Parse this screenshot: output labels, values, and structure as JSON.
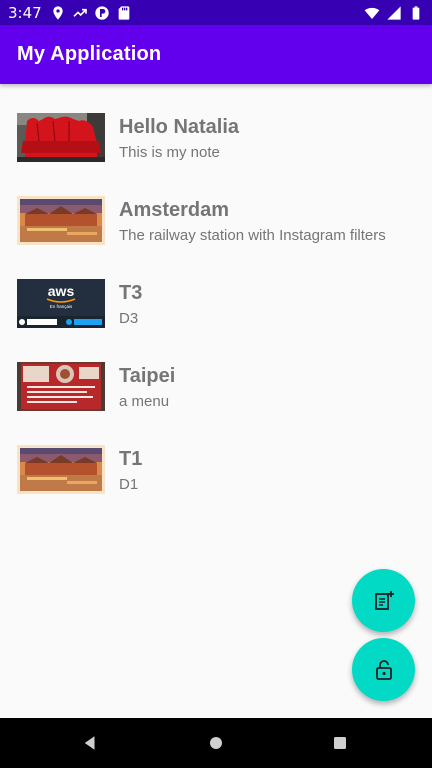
{
  "status_bar": {
    "time": "3:47",
    "icons": [
      "location-icon",
      "trending-icon",
      "p-badge-icon",
      "sd-card-icon",
      "wifi-icon",
      "signal-icon",
      "battery-icon"
    ]
  },
  "app_bar": {
    "title": "My Application"
  },
  "notes": [
    {
      "title": "Hello Natalia",
      "description": "This is my note",
      "image": "red-couch"
    },
    {
      "title": "Amsterdam",
      "description": "The railway station with Instagram filters",
      "image": "amsterdam-station"
    },
    {
      "title": "T3",
      "description": "D3",
      "image": "aws-card"
    },
    {
      "title": "Taipei",
      "description": "a menu",
      "image": "menu-photo"
    },
    {
      "title": "T1",
      "description": "D1",
      "image": "amsterdam-station"
    }
  ],
  "thumb_text": {
    "aws_logo": "aws",
    "aws_sub": "En français"
  },
  "fabs": {
    "add": "add-note-icon",
    "lock": "lock-icon"
  },
  "colors": {
    "status_bar": "#3700b3",
    "primary": "#6200ee",
    "accent": "#03dac5",
    "text_secondary": "#757575"
  },
  "nav_bar": {
    "buttons": [
      "back",
      "home",
      "recents"
    ]
  }
}
